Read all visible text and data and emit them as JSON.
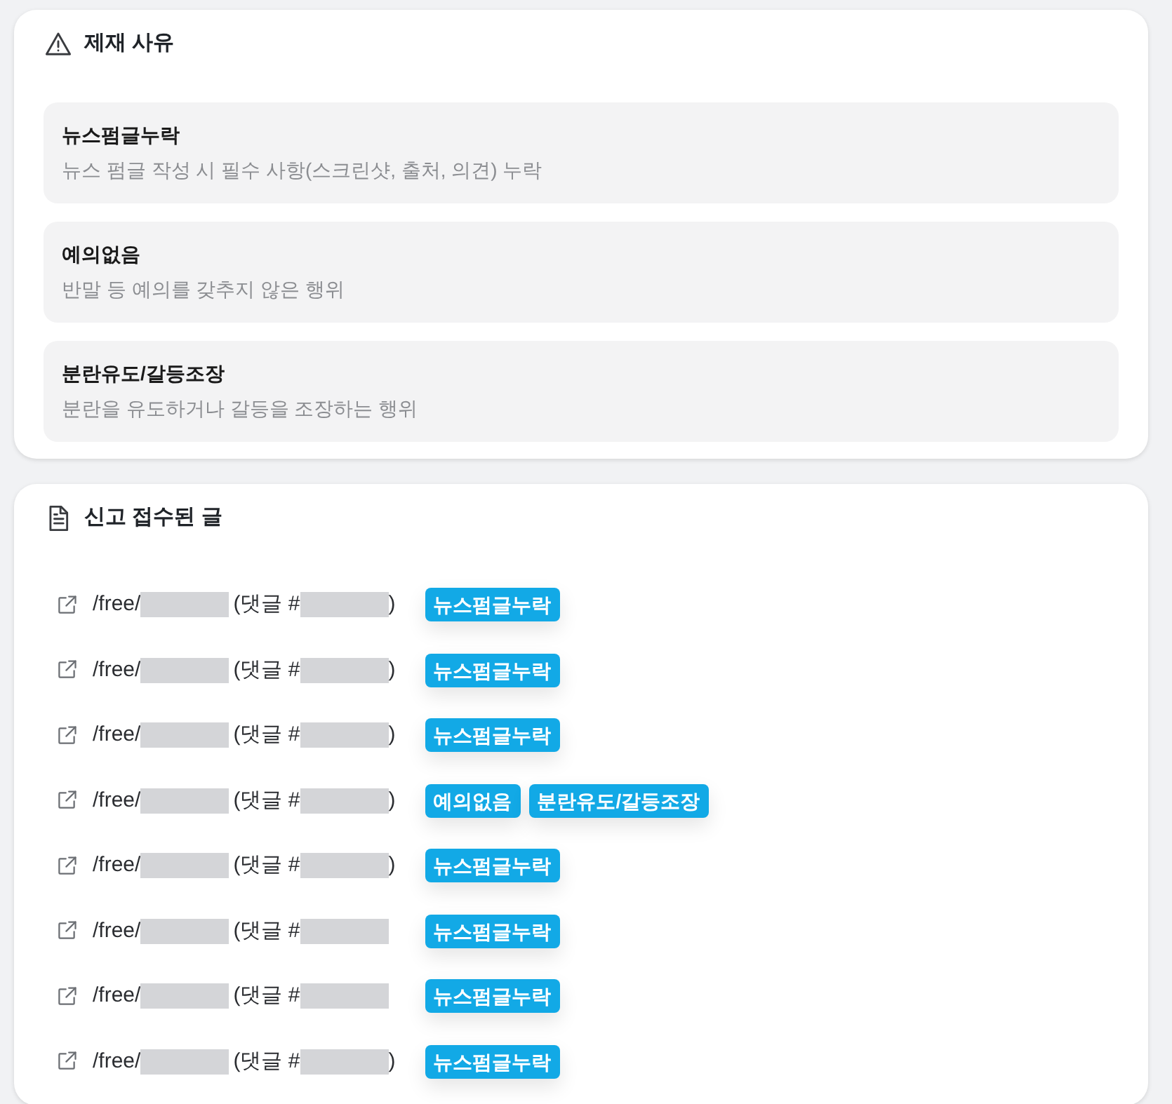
{
  "sanction_reasons": {
    "title": "제재 사유",
    "reasons": [
      {
        "title": "뉴스펌글누락",
        "description": "뉴스 펌글 작성 시 필수 사항(스크린샷, 출처, 의견) 누락"
      },
      {
        "title": "예의없음",
        "description": "반말 등 예의를 갖추지 않은 행위"
      },
      {
        "title": "분란유도/갈등조장",
        "description": "분란을 유도하거나 갈등을 조장하는 행위"
      }
    ]
  },
  "reported_posts": {
    "title": "신고 접수된 글",
    "items": [
      {
        "path": "/free/",
        "comment_label": "(댓글 #",
        "closing": ")",
        "tags": [
          "뉴스펌글누락"
        ]
      },
      {
        "path": "/free/",
        "comment_label": "(댓글 #",
        "closing": ")",
        "tags": [
          "뉴스펌글누락"
        ]
      },
      {
        "path": "/free/",
        "comment_label": "(댓글 #",
        "closing": ")",
        "tags": [
          "뉴스펌글누락"
        ]
      },
      {
        "path": "/free/",
        "comment_label": "(댓글 #",
        "closing": ")",
        "tags": [
          "예의없음",
          "분란유도/갈등조장"
        ]
      },
      {
        "path": "/free/",
        "comment_label": "(댓글 #",
        "closing": ")",
        "tags": [
          "뉴스펌글누락"
        ]
      },
      {
        "path": "/free/",
        "comment_label": "(댓글 #",
        "tags": [
          "뉴스펌글누락"
        ]
      },
      {
        "path": "/free/",
        "comment_label": "(댓글 #",
        "tags": [
          "뉴스펌글누락"
        ]
      },
      {
        "path": "/free/",
        "comment_label": "(댓글 #",
        "closing": ")",
        "tags": [
          "뉴스펌글누락"
        ]
      }
    ]
  }
}
